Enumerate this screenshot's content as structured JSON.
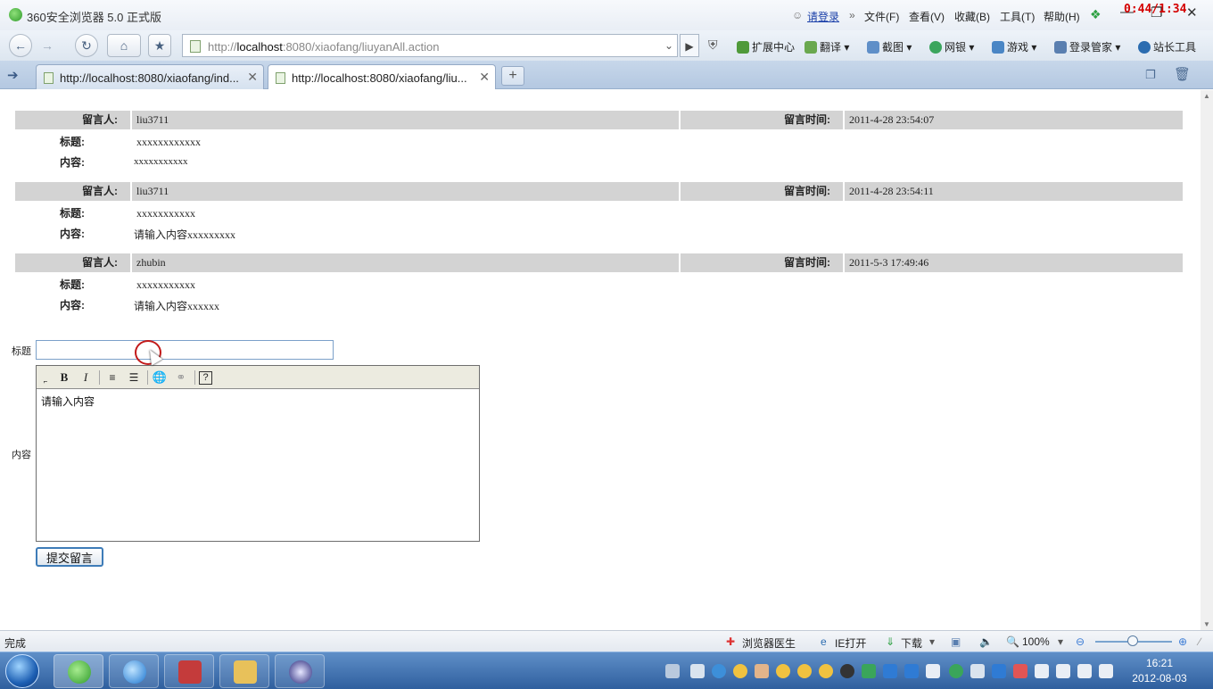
{
  "window": {
    "title": "360安全浏览器 5.0 正式版",
    "login_link": "请登录",
    "menus": [
      "文件(F)",
      "查看(V)",
      "收藏(B)",
      "工具(T)",
      "帮助(H)"
    ],
    "timer": "0:44/1:34",
    "min_glyph": "—",
    "max_glyph": "❐",
    "close_glyph": "✕"
  },
  "toolbar": {
    "address": {
      "prefix": "http://",
      "host": "localhost",
      "rest": ":8080/xiaofang/liuyanAll.action"
    },
    "items": {
      "extensions": "扩展中心",
      "translate": "翻译",
      "screenshot": "截图",
      "netbank": "网银",
      "games": "游戏",
      "login_manager": "登录管家",
      "webmaster": "站长工具"
    }
  },
  "tabs": [
    {
      "label": "http://localhost:8080/xiaofang/ind...",
      "active": false
    },
    {
      "label": "http://localhost:8080/xiaofang/liu...",
      "active": true
    }
  ],
  "labels": {
    "author": "留言人:",
    "time": "留言时间:",
    "title": "标题:",
    "content": "内容:"
  },
  "messages": [
    {
      "author": "liu3711",
      "time": "2011-4-28 23:54:07",
      "title": "xxxxxxxxxxxx",
      "content": "xxxxxxxxxxx"
    },
    {
      "author": "liu3711",
      "time": "2011-4-28 23:54:11",
      "title": "xxxxxxxxxxx",
      "content": "请输入内容xxxxxxxxx"
    },
    {
      "author": "zhubin",
      "time": "2011-5-3 17:49:46",
      "title": "xxxxxxxxxxx",
      "content": "请输入内容xxxxxx"
    }
  ],
  "form": {
    "title_label": "标题",
    "title_value": "",
    "content_label": "内容",
    "editor_text": "请输入内容",
    "submit_label": "提交留言",
    "editor_buttons": {
      "bold": "B",
      "italic": "I",
      "help": "?"
    }
  },
  "status": {
    "text": "完成",
    "doctor": "浏览器医生",
    "ie_open": "IE打开",
    "download": "下载",
    "zoom": "100%",
    "zoom_level_percent": 100
  },
  "clock": {
    "time": "16:21",
    "date": "2012-08-03"
  },
  "colors": {
    "row_bg": "#d3d3d3",
    "link": "#1a3fa8",
    "timer": "#d40000",
    "taskbar": "#2f5f9e"
  }
}
